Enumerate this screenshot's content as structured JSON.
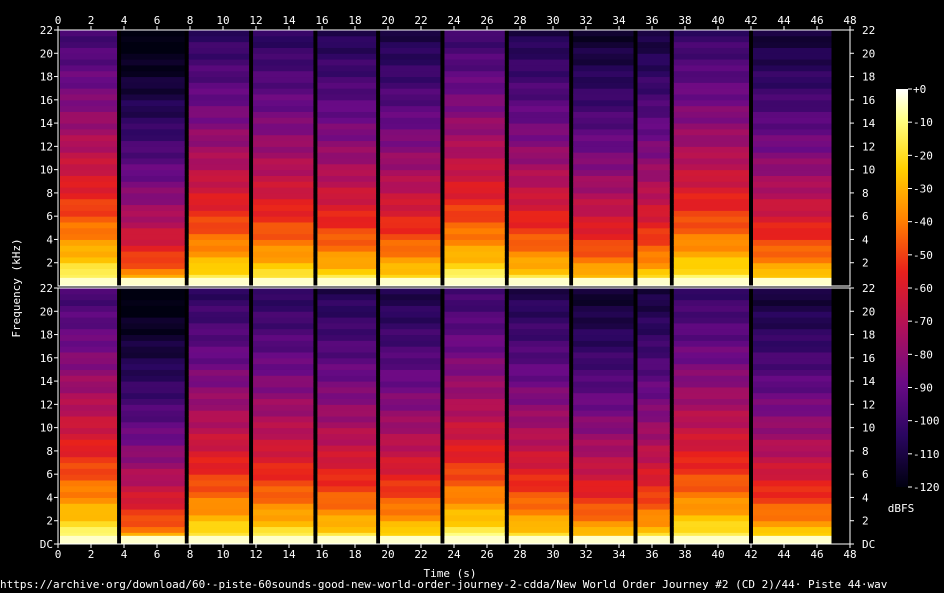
{
  "chart_data": {
    "type": "heatmap",
    "xlabel": "Time (s)",
    "ylabel": "Frequency (kHz)",
    "colorbar_label": "dBFS",
    "x_ticks": [
      "0",
      "2",
      "4",
      "6",
      "8",
      "10",
      "12",
      "14",
      "16",
      "18",
      "20",
      "22",
      "24",
      "26",
      "28",
      "30",
      "32",
      "34",
      "36",
      "38",
      "40",
      "42",
      "44",
      "46",
      "48"
    ],
    "xlim": [
      0,
      48
    ],
    "channels": [
      {
        "y_ticks": [
          "22",
          "20",
          "18",
          "16",
          "14",
          "12",
          "10",
          "8",
          "6",
          "4",
          "2"
        ],
        "ylim": [
          0,
          22
        ]
      },
      {
        "y_ticks": [
          "22",
          "20",
          "18",
          "16",
          "14",
          "12",
          "10",
          "8",
          "6",
          "4",
          "2",
          "DC"
        ],
        "ylim": [
          0,
          22
        ]
      }
    ],
    "colorbar_ticks": [
      "+0",
      "-10",
      "-20",
      "-30",
      "-40",
      "-50",
      "-60",
      "-70",
      "-80",
      "-90",
      "-100",
      "-110",
      "-120"
    ],
    "colorbar_range": [
      -120,
      0
    ],
    "colormap": [
      "#ffffff",
      "#ffff80",
      "#ffd000",
      "#ff8000",
      "#e8201c",
      "#b0105a",
      "#6a0a86",
      "#2a0660",
      "#000010"
    ],
    "segment_boundaries_s": [
      3.7,
      7.8,
      11.7,
      15.6,
      19.4,
      23.3,
      27.2,
      31.1,
      35.0,
      37.2,
      42.0,
      47.0
    ],
    "segment_loudness": [
      0.92,
      0.35,
      0.8,
      0.78,
      0.72,
      0.68,
      0.88,
      0.7,
      0.55,
      0.62,
      0.85,
      0.6
    ]
  },
  "footer": {
    "source": "https://archive·org/download/60·-piste-60sounds-good-new-world-order-journey-2-cdda/New World Order Journey #2 (CD 2)/44· Piste 44·wav"
  }
}
